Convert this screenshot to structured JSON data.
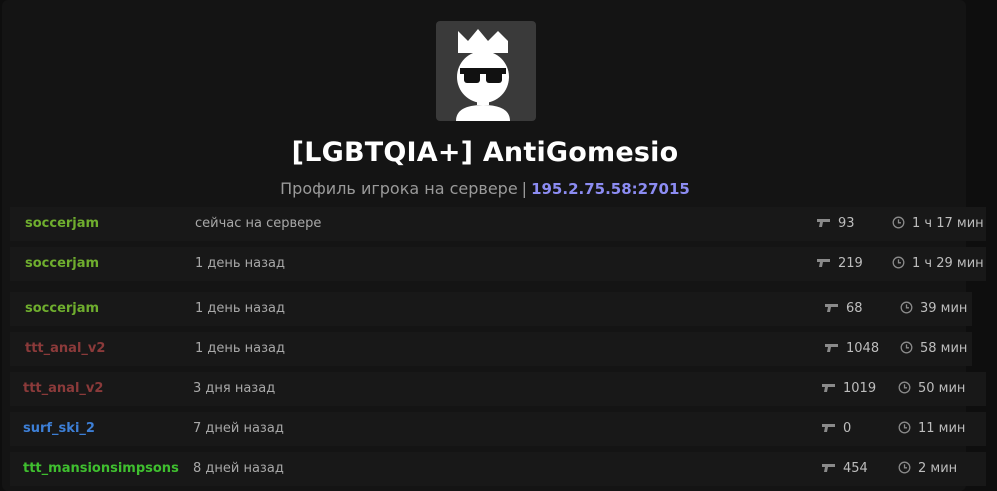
{
  "profile": {
    "name": "[LGBTQIA+] AntiGomesio",
    "subtitle": "Профиль игрока на сервере",
    "separator": "|",
    "server_ip": "195.2.75.58:27015",
    "avatar_icon": "crowned-face-with-sunglasses-icon"
  },
  "colors": {
    "background": "#141414",
    "row_background": "#181818",
    "ip_accent": "#8c8cf2",
    "map_soccerjam": "#6fae2e",
    "map_ttt_anal_v2": "#8b3a3a",
    "map_surf_ski_2": "#3d7fd6",
    "map_ttt_mansionsimpsons": "#3fbf2f"
  },
  "sessions": [
    {
      "map": "soccerjam",
      "when": "сейчас на сервере",
      "kills": "93",
      "time": "1 ч 17 мин",
      "color_class": "c-green"
    },
    {
      "map": "soccerjam",
      "when": "1 день назад",
      "kills": "219",
      "time": "1 ч 29 мин",
      "color_class": "c-green"
    },
    {
      "map": "soccerjam",
      "when": "1 день назад",
      "kills": "68",
      "time": "39 мин",
      "color_class": "c-green"
    },
    {
      "map": "ttt_anal_v2",
      "when": "1 день назад",
      "kills": "1048",
      "time": "58 мин",
      "color_class": "c-red"
    },
    {
      "map": "ttt_anal_v2",
      "when": "3 дня назад",
      "kills": "1019",
      "time": "50 мин",
      "color_class": "c-red"
    },
    {
      "map": "surf_ski_2",
      "when": "7 дней назад",
      "kills": "0",
      "time": "11 мин",
      "color_class": "c-blue"
    },
    {
      "map": "ttt_mansionsimpsons",
      "when": "8 дней назад",
      "kills": "454",
      "time": "2 мин",
      "color_class": "c-lime"
    }
  ]
}
